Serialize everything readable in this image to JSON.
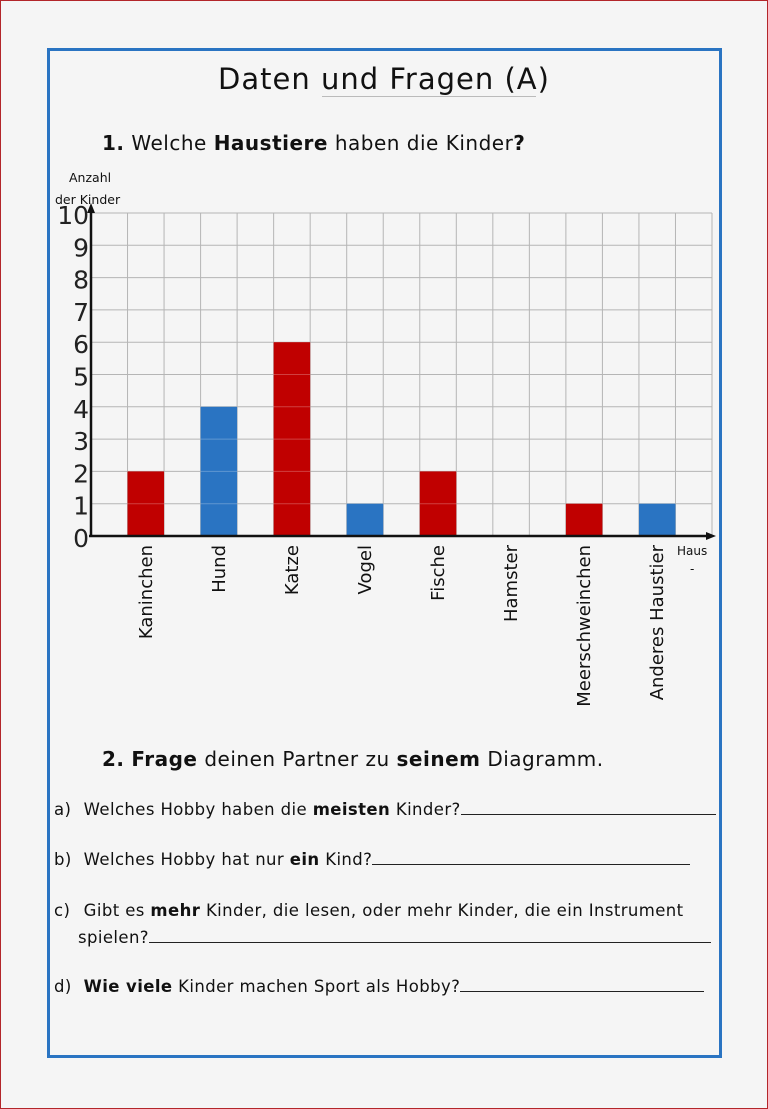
{
  "worksheet": {
    "title": "Daten und Fragen (A)",
    "task1": {
      "number": "1.",
      "pre": "Welche",
      "bold": "Haustiere",
      "post": "haben die Kinder",
      "mark": "?"
    },
    "task2": {
      "number": "2.",
      "bold1": "Frage",
      "mid": "deinen Partner zu",
      "bold2": "seinem",
      "post": "Diagramm."
    },
    "questions": [
      {
        "letter": "a)",
        "pre": "Welches Hobby haben die",
        "bold": "meisten",
        "post": "Kinder?"
      },
      {
        "letter": "b)",
        "pre": "Welches Hobby hat nur",
        "bold": "ein",
        "post": "Kind?"
      },
      {
        "letter": "c)",
        "pre": "Gibt es",
        "bold": "mehr",
        "post": "Kinder, die lesen, oder mehr Kinder, die ein Instrument",
        "cont": "spielen?"
      },
      {
        "letter": "d)",
        "pre": "",
        "bold": "Wie viele",
        "post": "Kinder machen Sport als Hobby?"
      }
    ]
  },
  "chart_data": {
    "type": "bar",
    "title": "Welche Haustiere haben die Kinder?",
    "ylabel_line1": "Anzahl",
    "ylabel_line2": "der Kinder",
    "xlabel_line1": "Haus",
    "xlabel_line2": "-",
    "ylim": [
      0,
      10
    ],
    "yticks": [
      "0",
      "1",
      "2",
      "3",
      "4",
      "5",
      "6",
      "7",
      "8",
      "9",
      "10"
    ],
    "grid": true,
    "categories": [
      "Kaninchen",
      "Hund",
      "Katze",
      "Vogel",
      "Fische",
      "Hamster",
      "Meerschweinchen",
      "Anderes Haustier"
    ],
    "values": [
      2,
      4,
      6,
      1,
      2,
      0,
      1,
      1
    ],
    "colors": [
      "#c00000",
      "#2a74c2",
      "#c00000",
      "#2a74c2",
      "#c00000",
      "#c00000",
      "#c00000",
      "#2a74c2"
    ]
  }
}
